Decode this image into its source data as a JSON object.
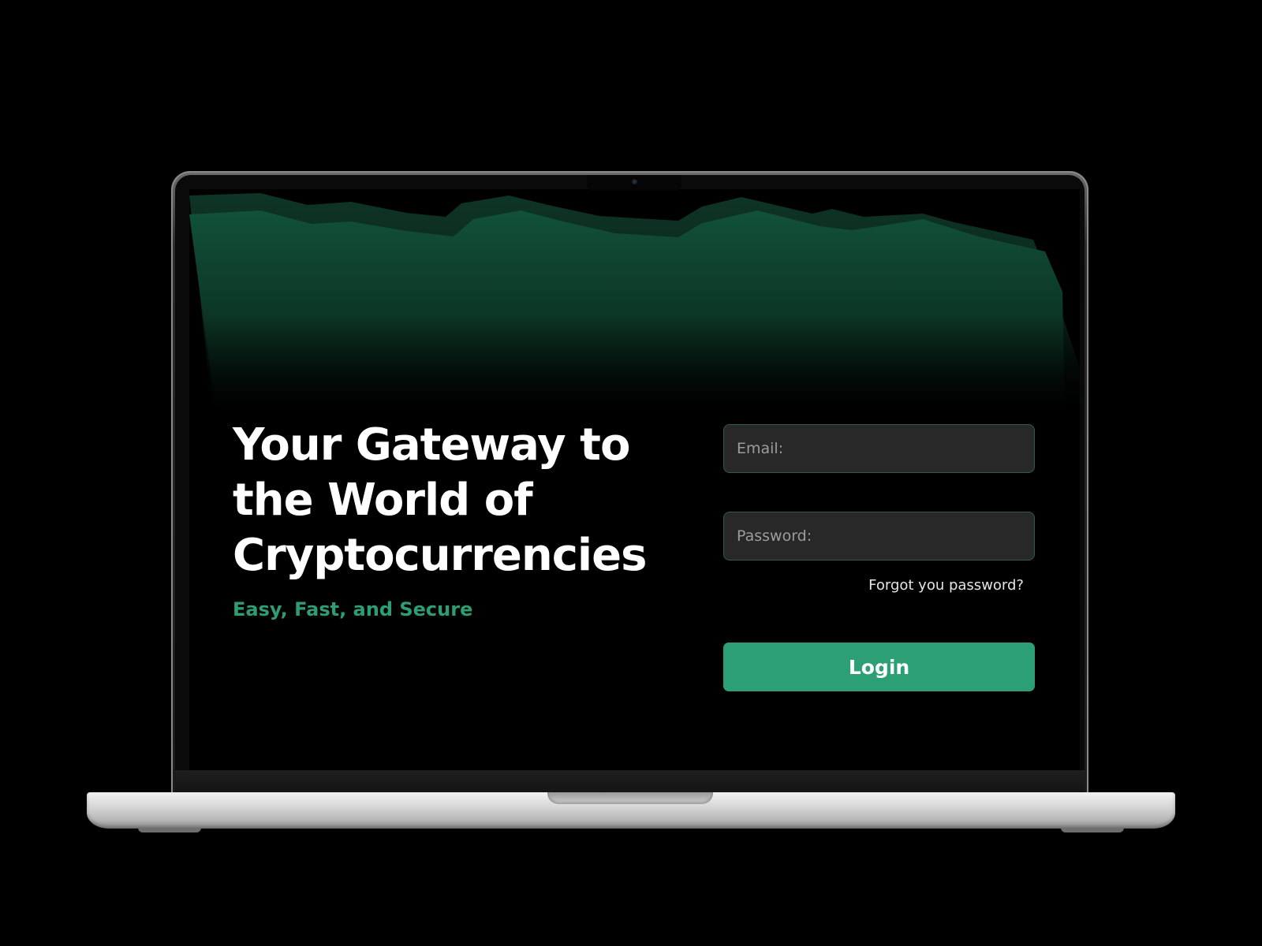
{
  "hero": {
    "headline": "Your Gateway to the World of Cryptocurrencies",
    "tagline": "Easy, Fast, and Secure"
  },
  "login_form": {
    "email_placeholder": "Email:",
    "email_value": "",
    "password_placeholder": "Password:",
    "password_value": "",
    "forgot_link": "Forgot you password?",
    "login_label": "Login"
  },
  "colors": {
    "background": "#000000",
    "accent": "#2ca074",
    "tagline": "#2e9e72",
    "field_background": "#282828",
    "field_border": "#2e5d49",
    "chart_fill": "#11513a"
  }
}
